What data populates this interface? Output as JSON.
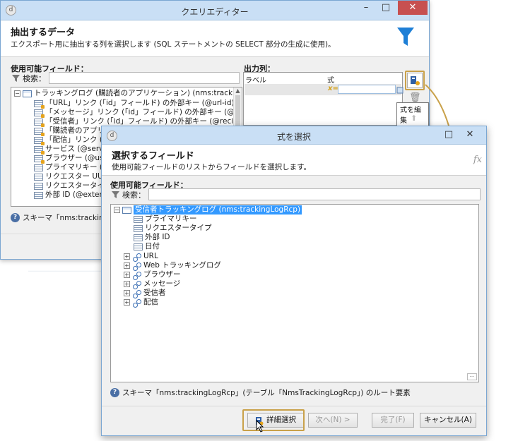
{
  "colors": {
    "accent": "#1e7fd6",
    "highlight": "#c9a14a",
    "close": "#c75050",
    "selection": "#3399ff"
  },
  "query_editor": {
    "title": "クエリエディター",
    "heading": "抽出するデータ",
    "description": "エクスポート用に抽出する列を選択します (SQL ステートメントの SELECT 部分の生成に使用)。",
    "available_fields_label": "使用可能フィールド：",
    "search_label": "検索：",
    "output_columns_label": "出力列：",
    "grid_headers": {
      "label": "ラベル",
      "expression": "式"
    },
    "expression_prefix": "x=",
    "edit_expression_tooltip": "式を編集",
    "tree": [
      {
        "label": "トラッキングログ (購読者のアプリケーション) (nms:trackingLogAppS",
        "icon": "table-icon"
      },
      {
        "label": "「URL」リンク (「id」フィールド) の外部キー (@url-id)",
        "icon": "foreign-key-icon"
      },
      {
        "label": "「メッセージ」リンク (「id」フィールド) の外部キー (@broadLog-id)",
        "icon": "foreign-key-icon"
      },
      {
        "label": "「受信者」リンク (「id」フィールド) の外部キー (@recipient-id)",
        "icon": "foreign-key-icon"
      },
      {
        "label": "「購読者のアプリケー",
        "icon": "foreign-key-icon"
      },
      {
        "label": "「配信」リンク (「id」フ",
        "icon": "foreign-key-icon"
      },
      {
        "label": "サービス (@service",
        "icon": "foreign-key-icon"
      },
      {
        "label": "ブラウザー (@user",
        "icon": "foreign-key-icon"
      },
      {
        "label": "プライマリキー (@id",
        "icon": "field-icon"
      },
      {
        "label": "リクエスター UUID (",
        "icon": "field-icon"
      },
      {
        "label": "リクエスタータイプ (@",
        "icon": "field-icon"
      },
      {
        "label": "外部 ID (@exter",
        "icon": "field-icon"
      }
    ],
    "schema_info": "スキーマ「nms:trackingLo"
  },
  "select_dialog": {
    "title": "式を選択",
    "heading": "選択するフィールド",
    "description": "使用可能フィールドのリストからフィールドを選択します。",
    "fx_label": "fx",
    "available_fields_label": "使用可能フィールド：",
    "search_label": "検索：",
    "tree": [
      {
        "label": "受信者トラッキングログ (nms:trackingLogRcp)",
        "icon": "table-icon",
        "expander": "−",
        "selected": true
      },
      {
        "label": "プライマリキー",
        "icon": "field-icon"
      },
      {
        "label": "リクエスタータイプ",
        "icon": "field-icon"
      },
      {
        "label": "外部 ID",
        "icon": "field-icon"
      },
      {
        "label": "日付",
        "icon": "field-icon"
      },
      {
        "label": "URL",
        "icon": "link-icon",
        "expander": "+"
      },
      {
        "label": "Web トラッキングログ",
        "icon": "link-icon",
        "expander": "+"
      },
      {
        "label": "ブラウザー",
        "icon": "link-icon",
        "expander": "+"
      },
      {
        "label": "メッセージ",
        "icon": "link-icon",
        "expander": "+"
      },
      {
        "label": "受信者",
        "icon": "link-icon",
        "expander": "+"
      },
      {
        "label": "配信",
        "icon": "link-icon",
        "expander": "+"
      }
    ],
    "schema_info": "スキーマ「nms:trackingLogRcp」(テーブル「NmsTrackingLogRcp」) のルート要素",
    "buttons": {
      "advanced": "詳細選択",
      "next": "次へ(N) >",
      "finish": "完了(F)",
      "cancel": "キャンセル(A)"
    }
  }
}
